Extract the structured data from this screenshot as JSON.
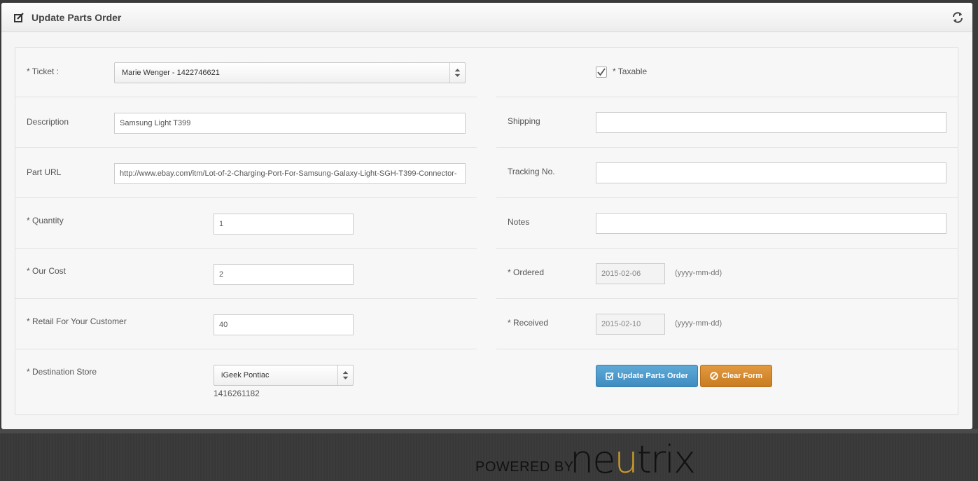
{
  "header": {
    "title": "Update Parts Order",
    "icon": "edit-icon",
    "refresh_icon": "refresh-icon"
  },
  "form": {
    "ticket": {
      "label": "* Ticket :",
      "value": "Marie Wenger - 1422746621"
    },
    "description": {
      "label": "Description",
      "value": "Samsung Light T399"
    },
    "part_url": {
      "label": "Part URL",
      "value": "http://www.ebay.com/itm/Lot-of-2-Charging-Port-For-Samsung-Galaxy-Light-SGH-T399-Connector-"
    },
    "quantity": {
      "label": "* Quantity",
      "value": "1"
    },
    "our_cost": {
      "label": "* Our Cost",
      "value": "2"
    },
    "retail": {
      "label": "* Retail For Your Customer",
      "value": "40"
    },
    "destination": {
      "label": "* Destination Store",
      "value": "iGeek Pontiac",
      "sub": "1416261182"
    },
    "taxable": {
      "label": "* Taxable",
      "checked": true
    },
    "shipping": {
      "label": "Shipping",
      "value": ""
    },
    "tracking": {
      "label": "Tracking No.",
      "value": ""
    },
    "notes": {
      "label": "Notes",
      "value": ""
    },
    "ordered": {
      "label": "* Ordered",
      "value": "2015-02-06",
      "hint": "(yyyy-mm-dd)"
    },
    "received": {
      "label": "* Received",
      "value": "2015-02-10",
      "hint": "(yyyy-mm-dd)"
    }
  },
  "buttons": {
    "update": "Update Parts Order",
    "clear": "Clear Form"
  },
  "footer": {
    "powered": "POWERED BY",
    "brand_a": "ne",
    "brand_b": "u",
    "brand_c": "trix"
  },
  "colors": {
    "accent_blue": "#4a9bcf",
    "accent_orange": "#d68a2e",
    "brand_gold": "#c89a2a"
  }
}
